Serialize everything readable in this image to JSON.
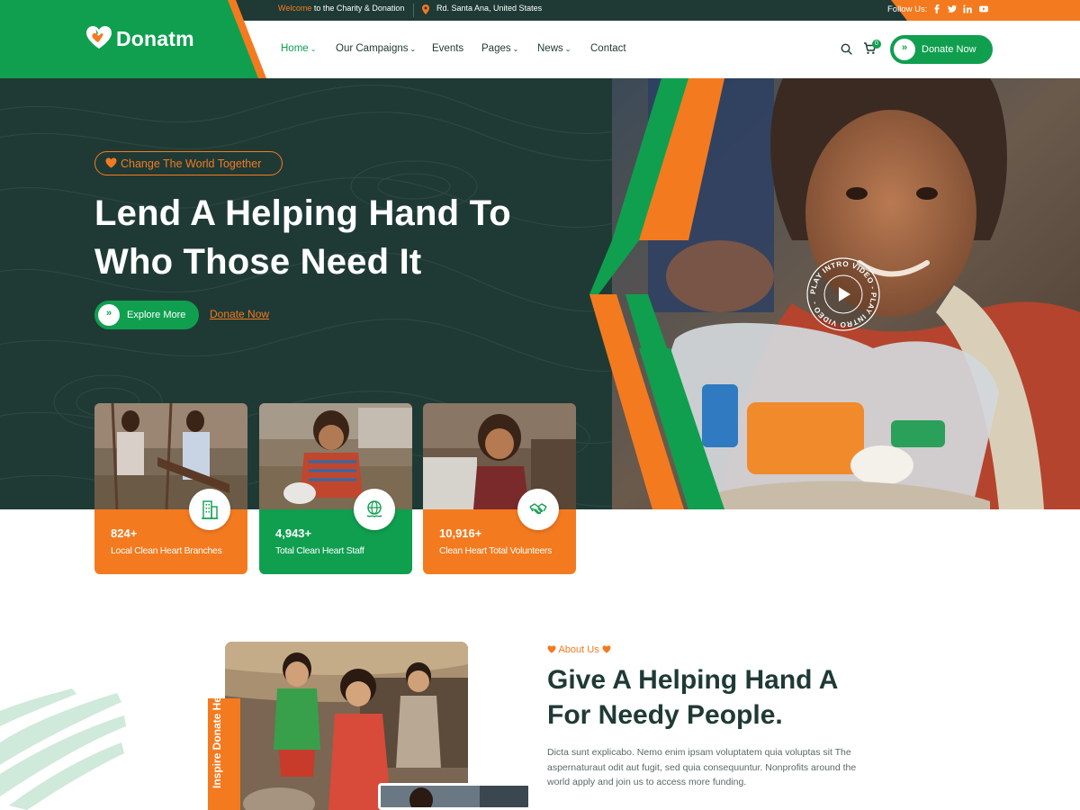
{
  "colors": {
    "dark": "#1f3a35",
    "green": "#0f9f4f",
    "orange": "#f47a1f"
  },
  "topbar": {
    "welcome_accent": "Welcome",
    "welcome_rest": " to the Charity & Donation",
    "address": "Rd. Santa Ana, United States",
    "follow_label": "Follow Us:",
    "social_icons": [
      "facebook-icon",
      "twitter-icon",
      "linkedin-icon",
      "youtube-icon"
    ]
  },
  "header": {
    "logo_text": "Donatm",
    "nav": [
      {
        "label": "Home",
        "active": true,
        "has_caret": true
      },
      {
        "label": "Our Campaigns",
        "has_caret": true
      },
      {
        "label": "Events",
        "has_caret": false
      },
      {
        "label": "Pages",
        "has_caret": true
      },
      {
        "label": "News",
        "has_caret": true
      },
      {
        "label": "Contact",
        "has_caret": false
      }
    ],
    "cart_count": "0",
    "donate_label": "Donate Now"
  },
  "hero": {
    "tag": "Change The World Together",
    "title_line1": "Lend A Helping Hand To",
    "title_line2": "Who Those Need It",
    "explore_label": "Explore More",
    "donate_link": "Donate Now",
    "play_text": "PLAY INTRO VIDEO - PLAY INTRO VIDEO -"
  },
  "stats": [
    {
      "value": "824+",
      "label": "Local Clean Heart Branches",
      "color": "#f47a1f",
      "icon": "building-icon"
    },
    {
      "value": "4,943+",
      "label": "Total Clean Heart Staff",
      "color": "#0f9f4f",
      "icon": "globe-icon"
    },
    {
      "value": "10,916+",
      "label": "Clean Heart Total Volunteers",
      "color": "#f47a1f",
      "icon": "handshake-icon"
    }
  ],
  "about": {
    "tag": "About Us",
    "title_line1": "Give A Helping Hand A",
    "title_line2": "For Needy People.",
    "body": "Dicta sunt explicabo. Nemo enim ipsam voluptatem quia voluptas sit The aspernaturaut odit aut fugit, sed quia consequuntur. Nonprofits around the world apply and join us to access more funding.",
    "vertical_tab": "Inspire Donate Help"
  }
}
